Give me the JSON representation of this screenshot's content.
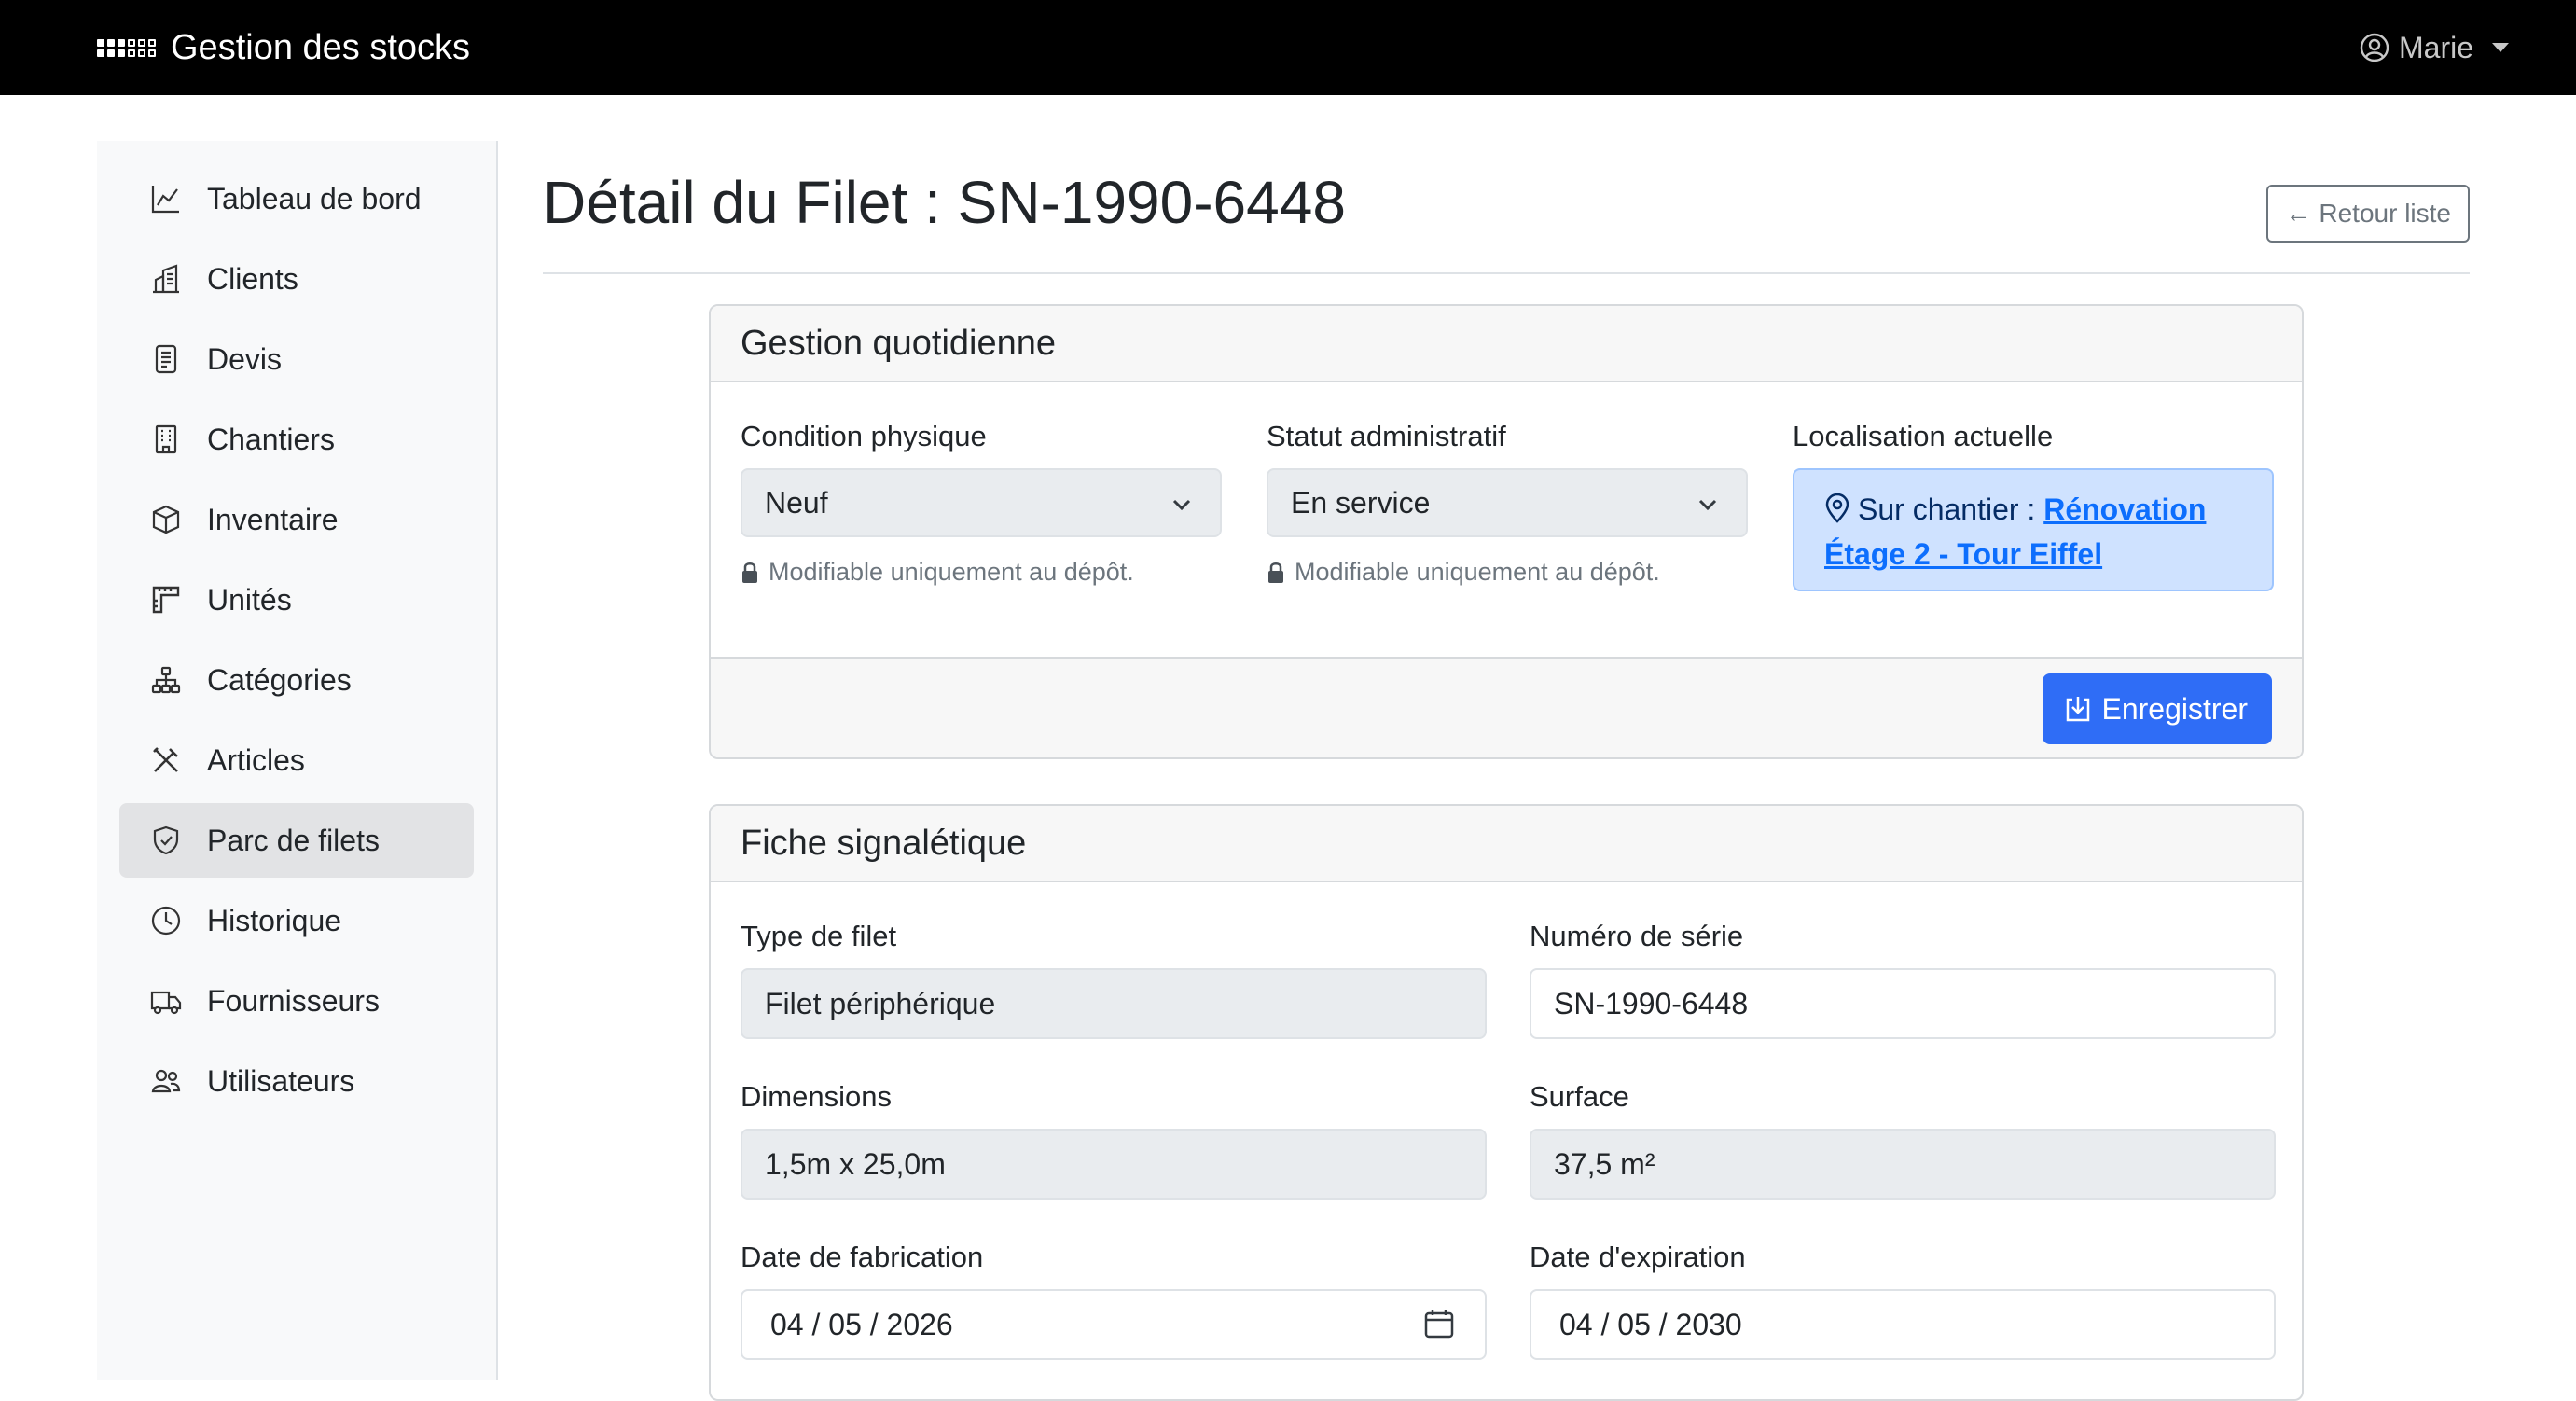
{
  "navbar": {
    "brand": "Gestion des stocks",
    "user_name": "Marie"
  },
  "sidebar": {
    "items": [
      {
        "label": "Tableau de bord",
        "icon": "chart-line-icon"
      },
      {
        "label": "Clients",
        "icon": "buildings-icon"
      },
      {
        "label": "Devis",
        "icon": "document-icon"
      },
      {
        "label": "Chantiers",
        "icon": "building-icon"
      },
      {
        "label": "Inventaire",
        "icon": "box-icon"
      },
      {
        "label": "Unités",
        "icon": "rulers-icon"
      },
      {
        "label": "Catégories",
        "icon": "diagram-icon"
      },
      {
        "label": "Articles",
        "icon": "tools-icon"
      },
      {
        "label": "Parc de filets",
        "icon": "shield-icon",
        "active": true
      },
      {
        "label": "Historique",
        "icon": "clock-icon"
      },
      {
        "label": "Fournisseurs",
        "icon": "truck-icon"
      },
      {
        "label": "Utilisateurs",
        "icon": "people-icon"
      }
    ]
  },
  "header": {
    "title": "Détail du Filet : SN-1990-6448",
    "back_label": "Retour liste"
  },
  "daily": {
    "title": "Gestion quotidienne",
    "condition_label": "Condition physique",
    "condition_value": "Neuf",
    "condition_help": "Modifiable uniquement au dépôt.",
    "status_label": "Statut administratif",
    "status_value": "En service",
    "status_help": "Modifiable uniquement au dépôt.",
    "location_label": "Localisation actuelle",
    "location_prefix": "Sur chantier :",
    "location_link": "Rénovation Étage 2 - Tour Eiffel",
    "save_label": "Enregistrer"
  },
  "sheet": {
    "title": "Fiche signalétique",
    "type_label": "Type de filet",
    "type_value": "Filet périphérique",
    "serial_label": "Numéro de série",
    "serial_value": "SN-1990-6448",
    "dimensions_label": "Dimensions",
    "dimensions_value": "1,5m x 25,0m",
    "surface_label": "Surface",
    "surface_value": "37,5 m²",
    "fab_label": "Date de fabrication",
    "fab_value": "04 / 05 / 2026",
    "exp_label": "Date d'expiration",
    "exp_value": "04 / 05 / 2030"
  },
  "colors": {
    "navbar": "#000000",
    "primary": "#2f6df6",
    "location_bg": "#cfe2ff"
  }
}
